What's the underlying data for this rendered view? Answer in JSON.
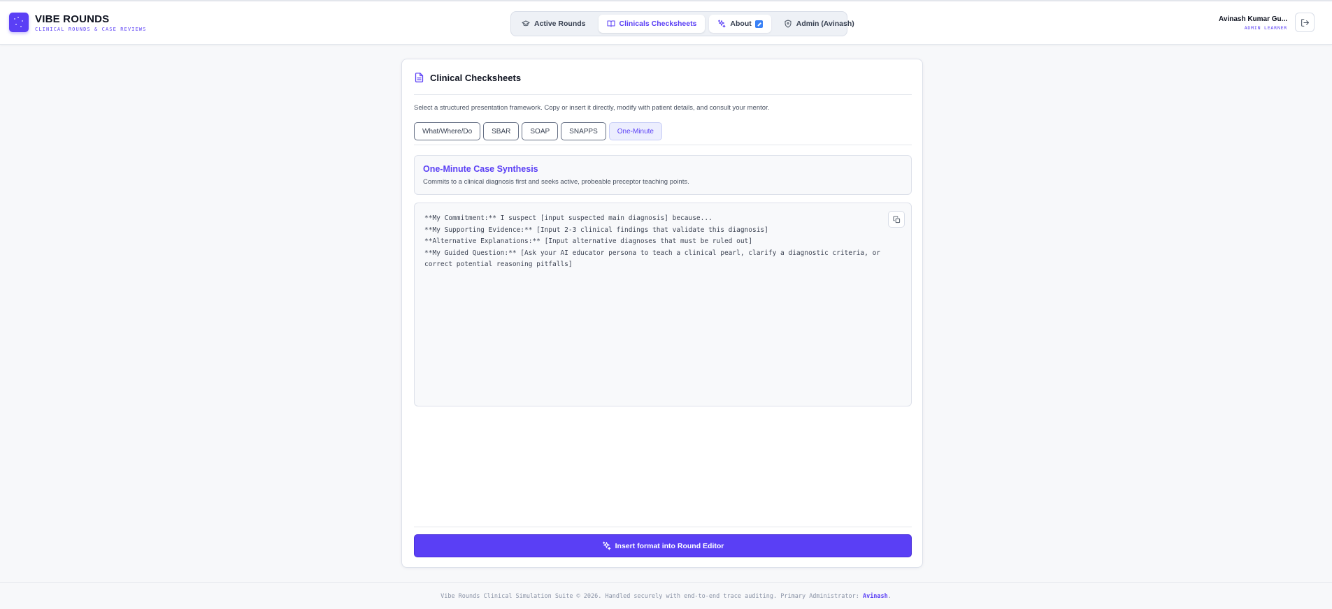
{
  "brand": {
    "title": "VIBE ROUNDS",
    "subtitle": "CLINICAL ROUNDS & CASE REVIEWS"
  },
  "nav": {
    "items": [
      {
        "label": "Active Rounds",
        "icon": "graduation-cap-icon"
      },
      {
        "label": "Clinicals Checksheets",
        "icon": "book-open-icon"
      },
      {
        "label": "About",
        "icon": "sparkles-icon"
      },
      {
        "label": "Admin (Avinash)",
        "icon": "shield-icon"
      }
    ],
    "active": "Clinicals Checksheets"
  },
  "user": {
    "name": "Avinash Kumar Gu...",
    "role": "ADMIN LEARNER"
  },
  "page": {
    "title": "Clinical Checksheets",
    "description": "Select a structured presentation framework. Copy or insert it directly, modify with patient details, and consult your mentor.",
    "tabs": [
      "What/Where/Do",
      "SBAR",
      "SOAP",
      "SNAPPS",
      "One-Minute"
    ],
    "active_tab": "One-Minute"
  },
  "framework": {
    "title": "One-Minute Case Synthesis",
    "description": "Commits to a clinical diagnosis first and seeks active, probeable preceptor teaching points.",
    "template": "**My Commitment:** I suspect [input suspected main diagnosis] because...\n**My Supporting Evidence:** [Input 2-3 clinical findings that validate this diagnosis]\n**Alternative Explanations:** [Input alternative diagnoses that must be ruled out]\n**My Guided Question:** [Ask your AI educator persona to teach a clinical pearl, clarify a diagnostic criteria, or correct potential reasoning pitfalls]"
  },
  "actions": {
    "insert_label": "Insert format into Round Editor"
  },
  "footer": {
    "text": "Vibe Rounds Clinical Simulation Suite © 2026. Handled securely with end-to-end trace auditing. Primary Administrator: ",
    "admin_link": "Avinash",
    "suffix": "."
  },
  "colors": {
    "accent": "#5a3ff5",
    "background": "#f7f8fa",
    "external_badge": "#3b82f6"
  }
}
